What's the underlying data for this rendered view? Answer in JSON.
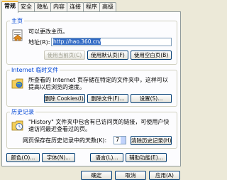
{
  "tabs": [
    {
      "label": "常规",
      "active": true
    },
    {
      "label": "安全",
      "active": false
    },
    {
      "label": "隐私",
      "active": false
    },
    {
      "label": "内容",
      "active": false
    },
    {
      "label": "连接",
      "active": false
    },
    {
      "label": "程序",
      "active": false
    },
    {
      "label": "高级",
      "active": false
    }
  ],
  "homepage": {
    "title": "主页",
    "desc": "可以更改主页。",
    "address_label": "地址(R):",
    "address_value": "http://hao.360.cn/",
    "btn_current": "使用当前页(C)",
    "btn_default": "使用默认页(F)",
    "btn_blank": "使用空白页(B)"
  },
  "temp_files": {
    "title": "Internet 临时文件",
    "desc_line1": "所查看的 Internet 页存储在特定的文件夹中，这样可以",
    "desc_line2": "提高以后浏览的速度。",
    "btn_cookies": "删除 Cookies(I)...",
    "btn_files": "删除文件(F)...",
    "btn_settings": "设置(S)..."
  },
  "history": {
    "title": "历史记录",
    "desc_line1": "\"History\" 文件夹中包含有已访问页的链接，可使用户快",
    "desc_line2": "速访问最近查看过的页。",
    "days_label": "网页保存在历史记录中的天数(K):",
    "days_value": "7",
    "btn_clear": "清除历史记录(H)"
  },
  "footer_buttons": {
    "colors": "颜色(O)...",
    "fonts": "字体(N)...",
    "languages": "语言(L)...",
    "accessibility": "辅助功能(E)..."
  },
  "dialog_buttons": {
    "ok": "确定",
    "cancel": "取消",
    "apply": "应用(A)"
  }
}
